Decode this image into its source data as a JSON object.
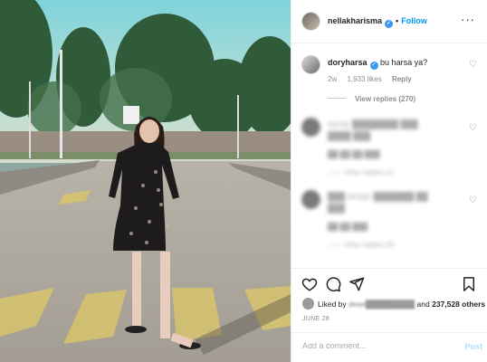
{
  "header": {
    "username": "nellakharisma",
    "separator": "•",
    "follow_label": "Follow",
    "more_icon": "more-horizontal-icon"
  },
  "comments": [
    {
      "username": "doryharsa",
      "verified": true,
      "text": "bu harsa ya?",
      "time": "2w",
      "likes": "1,933 likes",
      "reply_label": "Reply",
      "view_replies": "View replies (270)",
      "blurred": false
    },
    {
      "username": "hendy",
      "text": "",
      "time": "",
      "likes": "",
      "reply_label": "Reply",
      "view_replies": "View replies (1)",
      "blurred": true
    },
    {
      "username": "design",
      "text": "",
      "time": "",
      "likes": "",
      "reply_label": "Reply",
      "view_replies": "View replies (4)",
      "blurred": true
    }
  ],
  "actions": {
    "like_icon": "heart-outline-icon",
    "comment_icon": "comment-bubble-icon",
    "share_icon": "paper-plane-icon",
    "save_icon": "bookmark-icon",
    "liked_by_prefix": "Liked by",
    "liked_by_name": "dewi",
    "liked_by_and": "and",
    "liked_by_count": "237,528 others",
    "date": "JUNE 28"
  },
  "add_comment": {
    "placeholder": "Add a comment...",
    "post_label": "Post"
  },
  "colors": {
    "link": "#0095f6",
    "verified": "#3897f0",
    "post_disabled": "#b2dffc",
    "muted": "#8e8e8e"
  }
}
